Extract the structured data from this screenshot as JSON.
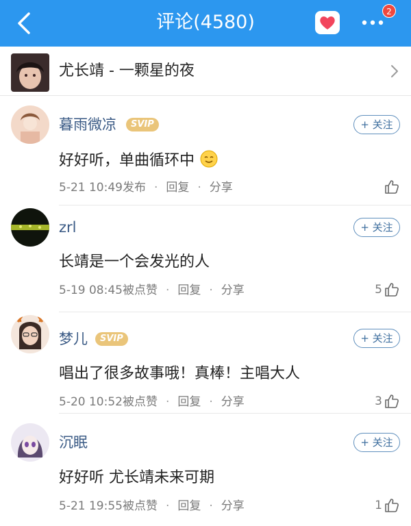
{
  "header": {
    "title": "评论(4580)",
    "badge_count": "2",
    "accent_color": "#2c97ef"
  },
  "song": {
    "title": "尤长靖 - 一颗星的夜"
  },
  "comments": [
    {
      "username": "暮雨微凉",
      "vip": "SVIP",
      "follow_label": "+ 关注",
      "text": "好好听，单曲循环中",
      "emoji": "smile",
      "time": "5-21 10:49发布",
      "reply": "回复",
      "share": "分享",
      "likes": ""
    },
    {
      "username": "zrl",
      "vip": "",
      "follow_label": "+ 关注",
      "text": "长靖是一个会发光的人",
      "time": "5-19 08:45被点赞",
      "reply": "回复",
      "share": "分享",
      "likes": "5"
    },
    {
      "username": "梦儿",
      "vip": "SVIP",
      "follow_label": "+ 关注",
      "text": "唱出了很多故事哦！真棒！主唱大人",
      "time": "5-20 10:52被点赞",
      "reply": "回复",
      "share": "分享",
      "likes": "3"
    },
    {
      "username": "沉眠",
      "vip": "",
      "follow_label": "+ 关注",
      "text": "好好听 尤长靖未来可期",
      "time": "5-21 19:55被点赞",
      "reply": "回复",
      "share": "分享",
      "likes": "1"
    }
  ]
}
